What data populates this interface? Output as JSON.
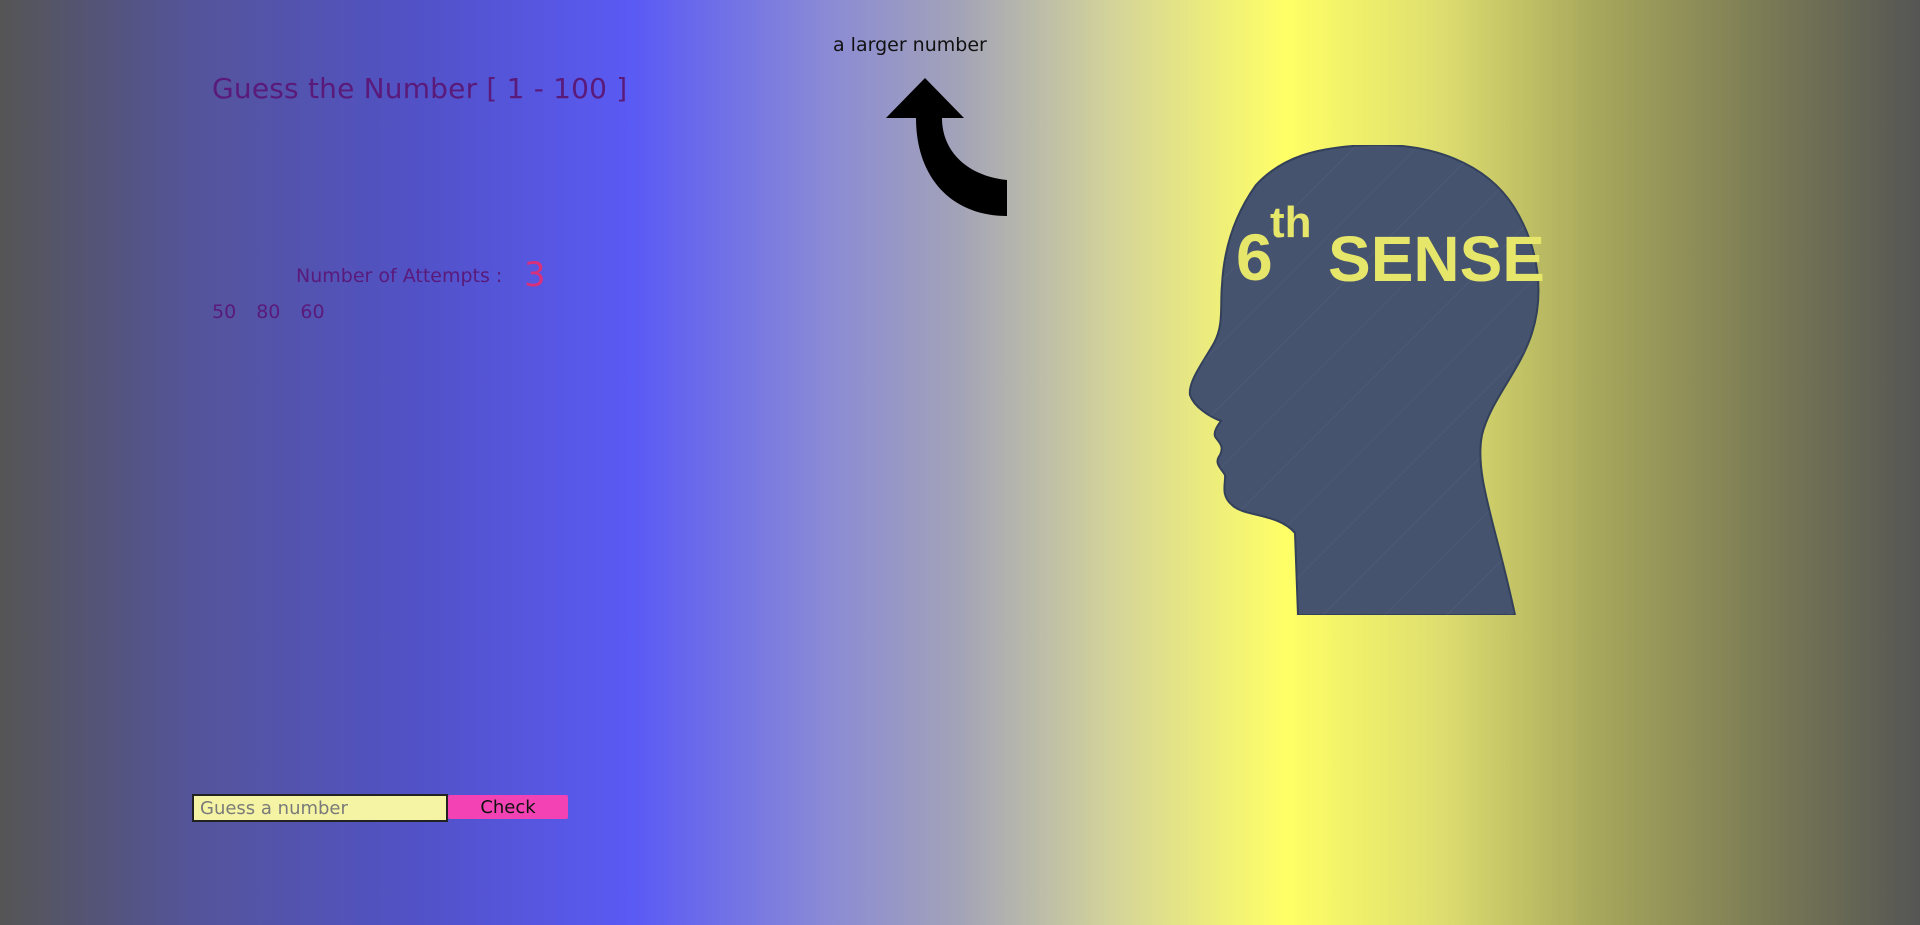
{
  "game": {
    "title": "Guess the Number [ 1 - 100 ]",
    "hint": "a larger number",
    "attempts_label": "Number of Attempts :",
    "attempts_count": "3",
    "previous_guesses": [
      "50",
      "80",
      "60"
    ]
  },
  "logo": {
    "ordinal": "6",
    "superscript": "th",
    "word": "SENSE"
  },
  "form": {
    "input_placeholder": "Guess a number",
    "input_value": "",
    "check_label": "Check"
  },
  "colors": {
    "title": "#5a1a7a",
    "attempts_value": "#d8307a",
    "button": "#f242b4",
    "input_bg": "#f4f4a4",
    "head_fill": "#46536f",
    "logo_text": "#e6e66a"
  }
}
